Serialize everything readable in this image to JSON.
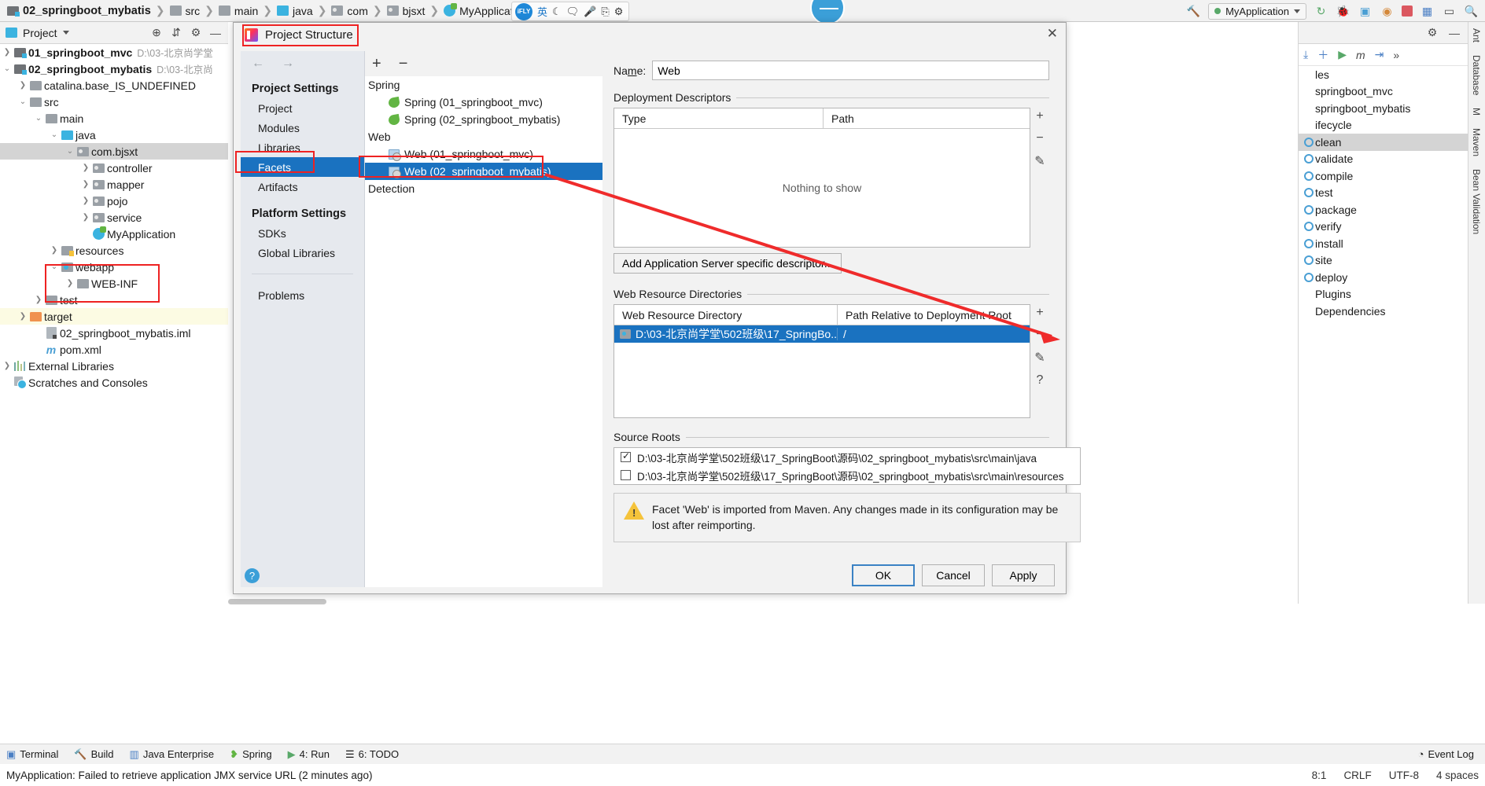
{
  "breadcrumbs": [
    {
      "label": "02_springboot_mybatis",
      "icon": "module-icon",
      "bold": true
    },
    {
      "label": "src",
      "icon": "folder-icon"
    },
    {
      "label": "main",
      "icon": "folder-icon"
    },
    {
      "label": "java",
      "icon": "source-folder-icon"
    },
    {
      "label": "com",
      "icon": "package-icon"
    },
    {
      "label": "bjsxt",
      "icon": "package-icon"
    },
    {
      "label": "MyApplication",
      "icon": "java-class-icon"
    }
  ],
  "ifly": {
    "logo": "iFLY",
    "glyphs": [
      "英",
      "☾",
      "🗨",
      "🎤",
      "⎘",
      "⚙"
    ]
  },
  "toolbar": {
    "run_config": "MyApplication",
    "icons": [
      "hammer-icon",
      "rerun-icon",
      "debug-icon",
      "coverage-icon",
      "profiler-icon",
      "stop-icon",
      "layout-icon",
      "terminal-icon",
      "search-icon"
    ]
  },
  "project_panel": {
    "title": "Project",
    "icons": [
      "locate-icon",
      "collapse-all-icon",
      "gear-icon",
      "minimize-icon"
    ],
    "tree": [
      {
        "label": "01_springboot_mvc",
        "path": "D:\\03-北京尚学堂",
        "indent": 0,
        "arrow": "right",
        "icon": "module-icon",
        "bold": true
      },
      {
        "label": "02_springboot_mybatis",
        "path": "D:\\03-北京尚",
        "indent": 0,
        "arrow": "down",
        "icon": "module-icon",
        "bold": true
      },
      {
        "label": "catalina.base_IS_UNDEFINED",
        "indent": 1,
        "arrow": "right",
        "icon": "folder-icon"
      },
      {
        "label": "src",
        "indent": 1,
        "arrow": "down",
        "icon": "folder-icon"
      },
      {
        "label": "main",
        "indent": 2,
        "arrow": "down",
        "icon": "folder-icon"
      },
      {
        "label": "java",
        "indent": 3,
        "arrow": "down",
        "icon": "source-folder-icon"
      },
      {
        "label": "com.bjsxt",
        "indent": 4,
        "arrow": "down",
        "icon": "package-icon",
        "selected": true
      },
      {
        "label": "controller",
        "indent": 5,
        "arrow": "right",
        "icon": "package-icon"
      },
      {
        "label": "mapper",
        "indent": 5,
        "arrow": "right",
        "icon": "package-icon"
      },
      {
        "label": "pojo",
        "indent": 5,
        "arrow": "right",
        "icon": "package-icon"
      },
      {
        "label": "service",
        "indent": 5,
        "arrow": "right",
        "icon": "package-icon"
      },
      {
        "label": "MyApplication",
        "indent": 5,
        "arrow": "none",
        "icon": "java-class-icon"
      },
      {
        "label": "resources",
        "indent": 3,
        "arrow": "right",
        "icon": "resource-folder-icon"
      },
      {
        "label": "webapp",
        "indent": 3,
        "arrow": "down",
        "icon": "web-folder-icon"
      },
      {
        "label": "WEB-INF",
        "indent": 4,
        "arrow": "right",
        "icon": "folder-icon"
      },
      {
        "label": "test",
        "indent": 2,
        "arrow": "right",
        "icon": "folder-icon"
      },
      {
        "label": "target",
        "indent": 1,
        "arrow": "right",
        "icon": "excluded-folder-icon",
        "highlight": true
      },
      {
        "label": "02_springboot_mybatis.iml",
        "indent": 2,
        "arrow": "none",
        "icon": "iml-file-icon"
      },
      {
        "label": "pom.xml",
        "indent": 2,
        "arrow": "none",
        "icon": "maven-file-icon"
      },
      {
        "label": "External Libraries",
        "indent": 0,
        "arrow": "right",
        "icon": "libraries-icon"
      },
      {
        "label": "Scratches and Consoles",
        "indent": 0,
        "arrow": "none",
        "icon": "scratches-icon"
      }
    ]
  },
  "dialog": {
    "title": "Project Structure",
    "close_label": "✕",
    "nav_back": "←",
    "nav_forward": "→",
    "sections": [
      {
        "title": "Project Settings",
        "items": [
          {
            "label": "Project"
          },
          {
            "label": "Modules"
          },
          {
            "label": "Libraries"
          },
          {
            "label": "Facets",
            "selected": true
          },
          {
            "label": "Artifacts"
          }
        ]
      },
      {
        "title": "Platform Settings",
        "items": [
          {
            "label": "SDKs"
          },
          {
            "label": "Global Libraries"
          }
        ]
      },
      {
        "title": "",
        "items": [
          {
            "label": "Problems"
          }
        ]
      }
    ],
    "facet_toolbar": {
      "add": "+",
      "remove": "−"
    },
    "facets": [
      {
        "type": "group",
        "label": "Spring"
      },
      {
        "type": "item",
        "label": "Spring (01_springboot_mvc)",
        "icon": "spring-leaf-icon"
      },
      {
        "type": "item",
        "label": "Spring (02_springboot_mybatis)",
        "icon": "spring-leaf-icon"
      },
      {
        "type": "group",
        "label": "Web"
      },
      {
        "type": "item",
        "label": "Web (01_springboot_mvc)",
        "icon": "web-facet-icon"
      },
      {
        "type": "item",
        "label": "Web (02_springboot_mybatis)",
        "icon": "web-facet-icon",
        "selected": true
      },
      {
        "type": "group",
        "label": "Detection"
      }
    ],
    "detail": {
      "name_label": "Name:",
      "name_value": "Web",
      "deployment_descriptors": {
        "title": "Deployment Descriptors",
        "columns": [
          "Type",
          "Path"
        ],
        "empty_text": "Nothing to show",
        "side_buttons": [
          "+",
          "−",
          "✎"
        ],
        "add_button": "Add Application Server specific descriptor..."
      },
      "web_resource_directories": {
        "title": "Web Resource Directories",
        "columns": [
          "Web Resource Directory",
          "Path Relative to Deployment Root"
        ],
        "rows": [
          {
            "directory": "D:\\03-北京尚学堂\\502班级\\17_SpringBo...",
            "path": "/"
          }
        ],
        "side_buttons": [
          "+",
          "−",
          "✎",
          "?"
        ]
      },
      "source_roots": {
        "title": "Source Roots",
        "rows": [
          {
            "checked": true,
            "path": "D:\\03-北京尚学堂\\502班级\\17_SpringBoot\\源码\\02_springboot_mybatis\\src\\main\\java"
          },
          {
            "checked": false,
            "path": "D:\\03-北京尚学堂\\502班级\\17_SpringBoot\\源码\\02_springboot_mybatis\\src\\main\\resources"
          }
        ]
      },
      "warning": "Facet 'Web' is imported from Maven. Any changes made in its configuration may be lost after reimporting."
    },
    "footer": {
      "help": "?",
      "ok": "OK",
      "cancel": "Cancel",
      "apply": "Apply"
    }
  },
  "maven_panel": {
    "header_icons": [
      "gear-icon",
      "minimize-icon"
    ],
    "toolbar_icons": [
      "download-icon",
      "add-icon",
      "run-icon",
      "m-icon",
      "toggle-icon",
      "more-icon"
    ],
    "items": [
      {
        "label": "les",
        "icon": "none",
        "partial": true
      },
      {
        "label": "springboot_mvc",
        "icon": "none",
        "partial": true
      },
      {
        "label": "springboot_mybatis",
        "icon": "none",
        "partial": true
      },
      {
        "label": "ifecycle",
        "icon": "none",
        "partial": true
      },
      {
        "label": "clean",
        "icon": "goal-icon",
        "selected": true
      },
      {
        "label": "validate",
        "icon": "goal-icon"
      },
      {
        "label": "compile",
        "icon": "goal-icon"
      },
      {
        "label": "test",
        "icon": "goal-icon"
      },
      {
        "label": "package",
        "icon": "goal-icon"
      },
      {
        "label": "verify",
        "icon": "goal-icon"
      },
      {
        "label": "install",
        "icon": "goal-icon"
      },
      {
        "label": "site",
        "icon": "goal-icon"
      },
      {
        "label": "deploy",
        "icon": "goal-icon"
      },
      {
        "label": "Plugins",
        "icon": "none",
        "partial": true
      },
      {
        "label": "Dependencies",
        "icon": "none",
        "partial": true
      }
    ],
    "vertical_tabs": [
      "Ant",
      "Database",
      "M",
      "Maven",
      "Bean Validation"
    ]
  },
  "status_bar": {
    "items": [
      {
        "label": "Terminal",
        "icon": "terminal-icon"
      },
      {
        "label": "Build",
        "icon": "build-icon"
      },
      {
        "label": "Java Enterprise",
        "icon": "java-ee-icon"
      },
      {
        "label": "Spring",
        "icon": "spring-icon"
      },
      {
        "label": "4: Run",
        "icon": "run-icon"
      },
      {
        "label": "6: TODO",
        "icon": "todo-icon"
      }
    ],
    "event_log": "Event Log"
  },
  "message_bar": {
    "text": "MyApplication: Failed to retrieve application JMX service URL (2 minutes ago)",
    "right": [
      "8:1",
      "CRLF",
      "UTF-8",
      "4 spaces"
    ]
  },
  "colors": {
    "accent": "#1a72c0",
    "annotation_red": "#ee2222",
    "selection_grey": "#d4d4d4",
    "panel_bg": "#f2f2f2"
  }
}
